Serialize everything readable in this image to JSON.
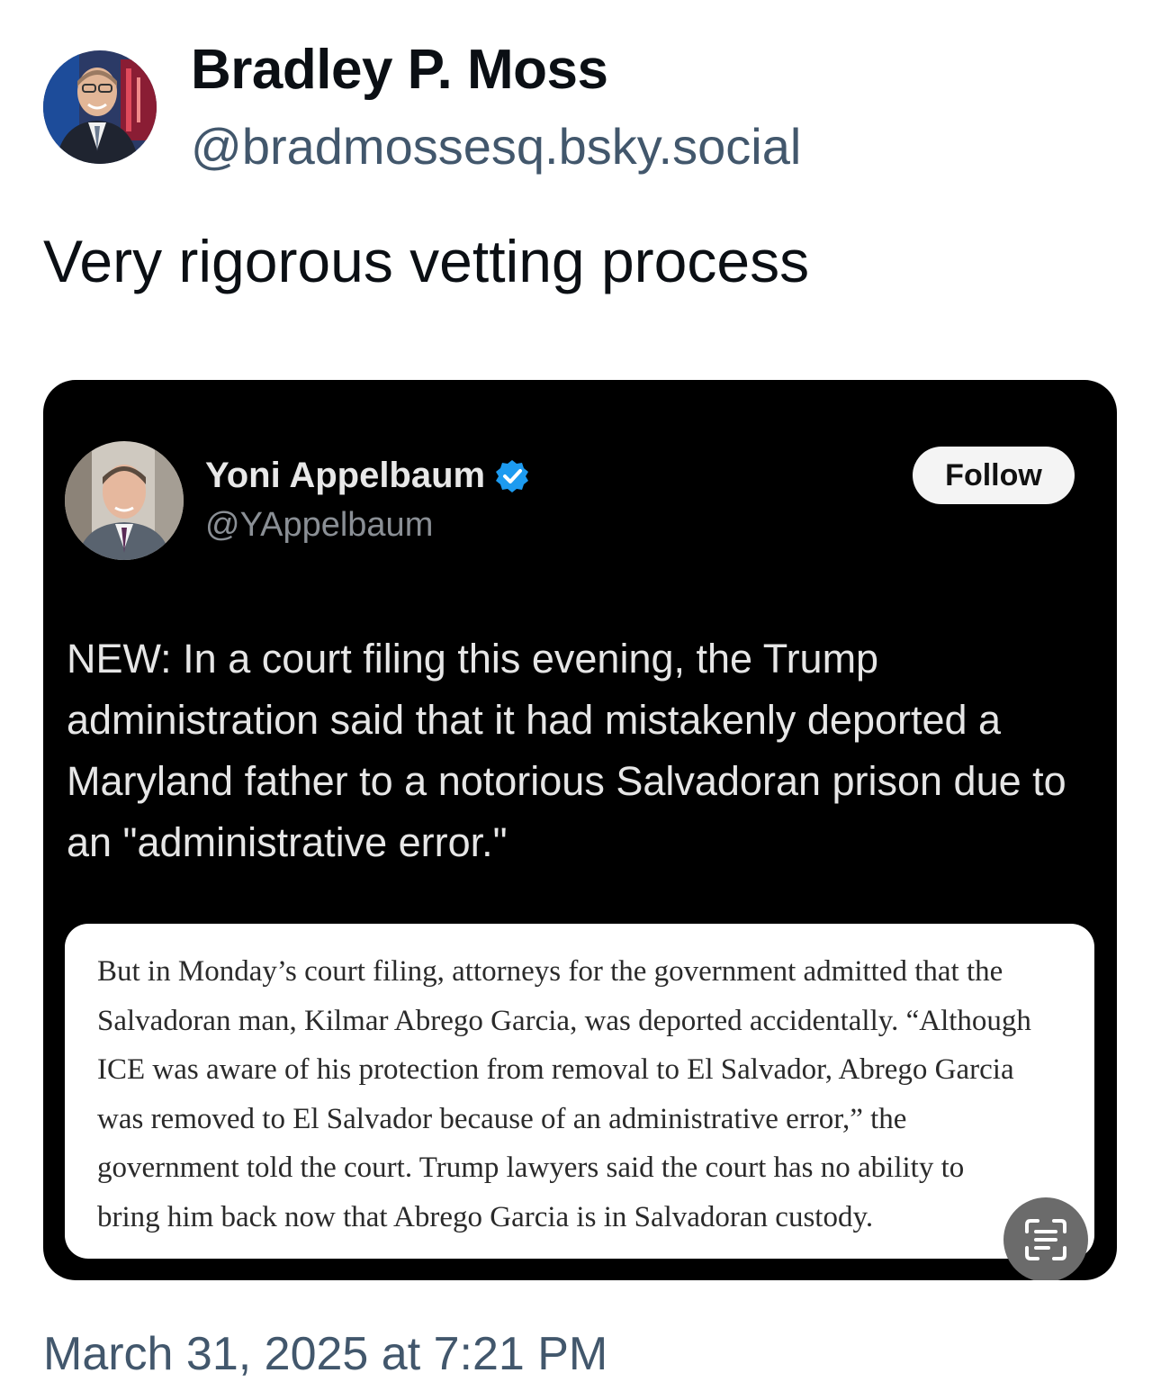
{
  "post": {
    "author": {
      "display_name": "Bradley P. Moss",
      "handle": "@bradmossesq.bsky.social"
    },
    "text": "Very rigorous vetting process",
    "timestamp": "March 31, 2025 at 7:21 PM"
  },
  "embed": {
    "author": {
      "display_name": "Yoni Appelbaum",
      "handle": "@YAppelbaum",
      "verified": true
    },
    "follow_label": "Follow",
    "text": "NEW: In a court filing this evening, the Trump administration said that it had mistakenly deported a Maryland father to a notorious Salvadoran prison due to an \"administrative error.\"",
    "excerpt": "But in Monday’s court filing, attorneys for the government admitted that the\nSalvadoran man, Kilmar Abrego Garcia, was deported accidentally. “Although\nICE was aware of his protection from removal to El Salvador, Abrego Garcia\nwas removed to El Salvador because of an administrative error,” the\ngovernment told the court. Trump lawyers said the court has no ability to\nbring him back now that Abrego Garcia is in Salvadoran custody."
  },
  "colors": {
    "handle_gray": "#42576c",
    "verified_blue": "#1d9bf0",
    "embed_bg": "#000000"
  },
  "icons": [
    "verified-badge-icon",
    "text-scan-icon"
  ]
}
